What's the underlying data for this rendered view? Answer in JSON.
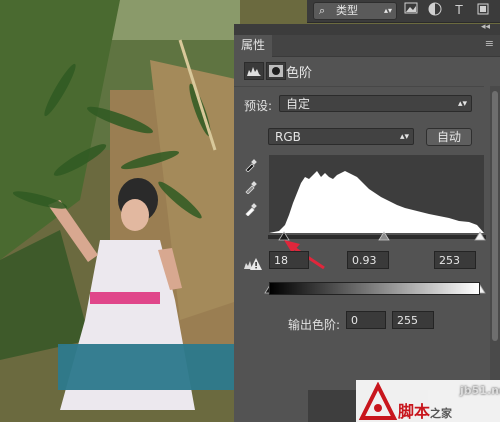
{
  "toolbar": {
    "kind_label": "类型",
    "type_icon": "T",
    "image_icon": "image-filter-icon",
    "circle_icon": "adjustment-filter-icon",
    "shape_icon": "shape-filter-icon"
  },
  "panel": {
    "tab_label": "属性",
    "title": "色阶",
    "preset_label": "预设:",
    "preset_value": "自定",
    "channel_value": "RGB",
    "auto_label": "自动",
    "input_black": "18",
    "input_gamma": "0.93",
    "input_white": "253",
    "output_label": "输出色阶:",
    "output_black": "0",
    "output_white": "255"
  },
  "watermark": {
    "url": "jb51.net",
    "brand": "脚本之家",
    "brand_part1": "脚本",
    "brand_part2": "之家"
  },
  "colors": {
    "panel_bg": "#535353",
    "arrow": "#e0263b",
    "overlay_bar": "#2e7a8d",
    "watermark_red": "#c8161d"
  }
}
